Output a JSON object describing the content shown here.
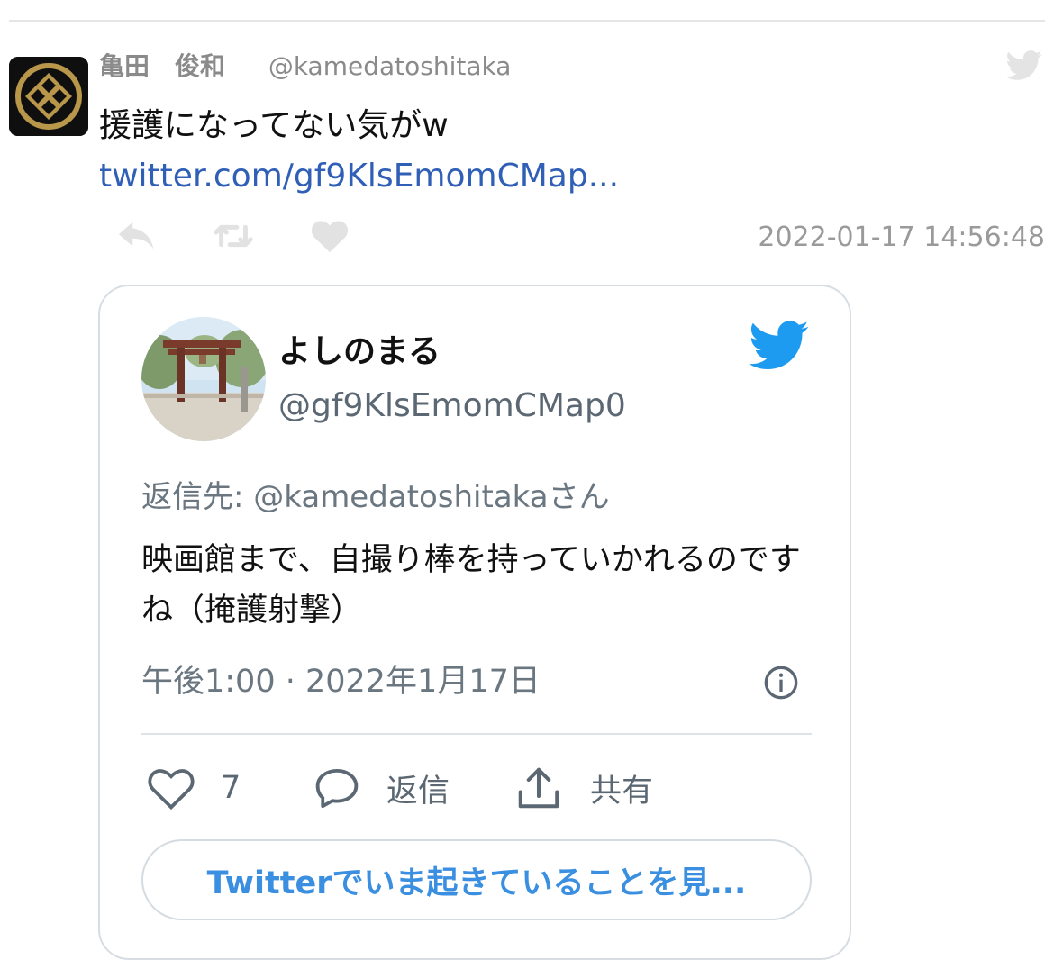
{
  "tweet": {
    "author_name": "亀田　俊和",
    "author_handle": "@kamedatoshitaka",
    "text": "援護になってない気がw",
    "link": "twitter.com/gf9KlsEmomCMap...",
    "timestamp": "2022-01-17 14:56:48"
  },
  "embed": {
    "name": "よしのまる",
    "handle": "@gf9KlsEmomCMap0",
    "reply_to": "返信先: @kamedatoshitakaさん",
    "body": "映画館まで、自撮り棒を持っていかれるのですね（掩護射撃）",
    "time": "午後1:00 · 2022年1月17日",
    "like_count": "7",
    "reply_label": "返信",
    "share_label": "共有",
    "cta_label": "Twitterでいま起きていることを見..."
  },
  "colors": {
    "twitter_blue": "#1d9bf0",
    "link_blue": "#2f5fb6",
    "muted_gray": "#9a9a9a"
  },
  "icons": [
    "kamon-avatar",
    "twitter-bird-icon",
    "reply-icon",
    "retweet-icon",
    "heart-icon",
    "info-icon",
    "share-icon",
    "comment-icon"
  ]
}
